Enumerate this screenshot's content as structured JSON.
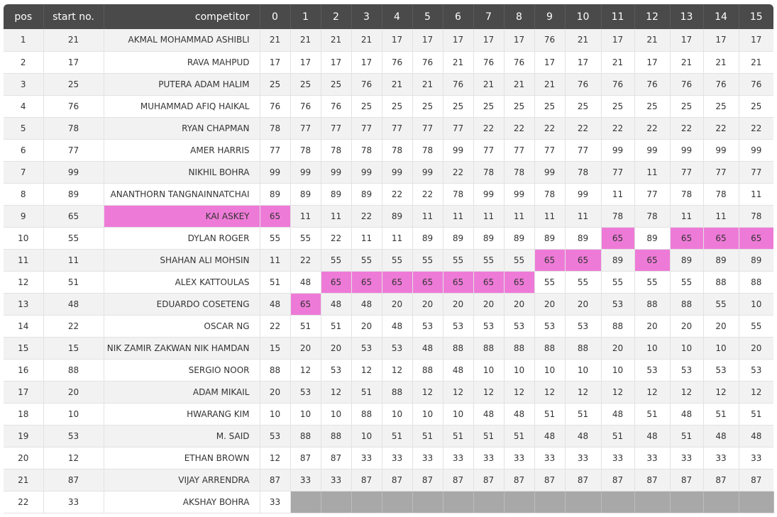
{
  "highlight_color": "#ee7ad7",
  "empty_color": "#a8a8a8",
  "header_color": "#4a4a4a",
  "highlighted_competitor": "KAI ASKEY",
  "highlighted_start_no": 65,
  "headers": {
    "pos": "pos",
    "start_no": "start no.",
    "competitor": "competitor",
    "laps": [
      "0",
      "1",
      "2",
      "3",
      "4",
      "5",
      "6",
      "7",
      "8",
      "9",
      "10",
      "11",
      "12",
      "13",
      "14",
      "15"
    ]
  },
  "rows": [
    {
      "pos": "1",
      "start_no": "21",
      "competitor": "AKMAL MOHAMMAD ASHIBLI",
      "laps": [
        "21",
        "21",
        "21",
        "21",
        "17",
        "17",
        "17",
        "17",
        "17",
        "76",
        "21",
        "17",
        "21",
        "17",
        "17",
        "17"
      ]
    },
    {
      "pos": "2",
      "start_no": "17",
      "competitor": "RAVA MAHPUD",
      "laps": [
        "17",
        "17",
        "17",
        "17",
        "76",
        "76",
        "21",
        "76",
        "76",
        "17",
        "17",
        "21",
        "17",
        "21",
        "21",
        "21"
      ]
    },
    {
      "pos": "3",
      "start_no": "25",
      "competitor": "PUTERA ADAM HALIM",
      "laps": [
        "25",
        "25",
        "25",
        "76",
        "21",
        "21",
        "76",
        "21",
        "21",
        "21",
        "76",
        "76",
        "76",
        "76",
        "76",
        "76"
      ]
    },
    {
      "pos": "4",
      "start_no": "76",
      "competitor": "MUHAMMAD AFIQ HAIKAL",
      "laps": [
        "76",
        "76",
        "76",
        "25",
        "25",
        "25",
        "25",
        "25",
        "25",
        "25",
        "25",
        "25",
        "25",
        "25",
        "25",
        "25"
      ]
    },
    {
      "pos": "5",
      "start_no": "78",
      "competitor": "RYAN CHAPMAN",
      "laps": [
        "78",
        "77",
        "77",
        "77",
        "77",
        "77",
        "77",
        "22",
        "22",
        "22",
        "22",
        "22",
        "22",
        "22",
        "22",
        "22"
      ]
    },
    {
      "pos": "6",
      "start_no": "77",
      "competitor": "AMER HARRIS",
      "laps": [
        "77",
        "78",
        "78",
        "78",
        "78",
        "78",
        "99",
        "77",
        "77",
        "77",
        "77",
        "99",
        "99",
        "99",
        "99",
        "99"
      ]
    },
    {
      "pos": "7",
      "start_no": "99",
      "competitor": "NIKHIL BOHRA",
      "laps": [
        "99",
        "99",
        "99",
        "99",
        "99",
        "99",
        "22",
        "78",
        "78",
        "99",
        "78",
        "77",
        "11",
        "77",
        "77",
        "77"
      ]
    },
    {
      "pos": "8",
      "start_no": "89",
      "competitor": "ANANTHORN TANGNAINNATCHAI",
      "laps": [
        "89",
        "89",
        "89",
        "89",
        "22",
        "22",
        "78",
        "99",
        "99",
        "78",
        "99",
        "11",
        "77",
        "78",
        "78",
        "11"
      ]
    },
    {
      "pos": "9",
      "start_no": "65",
      "competitor": "KAI ASKEY",
      "laps": [
        "65",
        "11",
        "11",
        "22",
        "89",
        "11",
        "11",
        "11",
        "11",
        "11",
        "11",
        "78",
        "78",
        "11",
        "11",
        "78"
      ]
    },
    {
      "pos": "10",
      "start_no": "55",
      "competitor": "DYLAN ROGER",
      "laps": [
        "55",
        "55",
        "22",
        "11",
        "11",
        "89",
        "89",
        "89",
        "89",
        "89",
        "89",
        "65",
        "89",
        "65",
        "65",
        "65"
      ]
    },
    {
      "pos": "11",
      "start_no": "11",
      "competitor": "SHAHAN ALI MOHSIN",
      "laps": [
        "11",
        "22",
        "55",
        "55",
        "55",
        "55",
        "55",
        "55",
        "55",
        "65",
        "65",
        "89",
        "65",
        "89",
        "89",
        "89"
      ]
    },
    {
      "pos": "12",
      "start_no": "51",
      "competitor": "ALEX KATTOULAS",
      "laps": [
        "51",
        "48",
        "65",
        "65",
        "65",
        "65",
        "65",
        "65",
        "65",
        "55",
        "55",
        "55",
        "55",
        "55",
        "88",
        "88"
      ]
    },
    {
      "pos": "13",
      "start_no": "48",
      "competitor": "EDUARDO COSETENG",
      "laps": [
        "48",
        "65",
        "48",
        "48",
        "20",
        "20",
        "20",
        "20",
        "20",
        "20",
        "20",
        "53",
        "88",
        "88",
        "55",
        "10"
      ]
    },
    {
      "pos": "14",
      "start_no": "22",
      "competitor": "OSCAR NG",
      "laps": [
        "22",
        "51",
        "51",
        "20",
        "48",
        "53",
        "53",
        "53",
        "53",
        "53",
        "53",
        "88",
        "20",
        "20",
        "20",
        "55"
      ]
    },
    {
      "pos": "15",
      "start_no": "15",
      "competitor": "NIK ZAMIR ZAKWAN NIK HAMDAN",
      "laps": [
        "15",
        "20",
        "20",
        "53",
        "53",
        "48",
        "88",
        "88",
        "88",
        "88",
        "88",
        "20",
        "10",
        "10",
        "10",
        "20"
      ]
    },
    {
      "pos": "16",
      "start_no": "88",
      "competitor": "SERGIO NOOR",
      "laps": [
        "88",
        "12",
        "53",
        "12",
        "12",
        "88",
        "48",
        "10",
        "10",
        "10",
        "10",
        "10",
        "53",
        "53",
        "53",
        "53"
      ]
    },
    {
      "pos": "17",
      "start_no": "20",
      "competitor": "ADAM MIKAIL",
      "laps": [
        "20",
        "53",
        "12",
        "51",
        "88",
        "12",
        "12",
        "12",
        "12",
        "12",
        "12",
        "12",
        "12",
        "12",
        "12",
        "12"
      ]
    },
    {
      "pos": "18",
      "start_no": "10",
      "competitor": "HWARANG KIM",
      "laps": [
        "10",
        "10",
        "10",
        "88",
        "10",
        "10",
        "10",
        "48",
        "48",
        "51",
        "51",
        "48",
        "51",
        "48",
        "51",
        "51"
      ]
    },
    {
      "pos": "19",
      "start_no": "53",
      "competitor": "M. SAID",
      "laps": [
        "53",
        "88",
        "88",
        "10",
        "51",
        "51",
        "51",
        "51",
        "51",
        "48",
        "48",
        "51",
        "48",
        "51",
        "48",
        "48"
      ]
    },
    {
      "pos": "20",
      "start_no": "12",
      "competitor": "ETHAN BROWN",
      "laps": [
        "12",
        "87",
        "87",
        "33",
        "33",
        "33",
        "33",
        "33",
        "33",
        "33",
        "33",
        "33",
        "33",
        "33",
        "33",
        "33"
      ]
    },
    {
      "pos": "21",
      "start_no": "87",
      "competitor": "VIJAY ARRENDRA",
      "laps": [
        "87",
        "33",
        "33",
        "87",
        "87",
        "87",
        "87",
        "87",
        "87",
        "87",
        "87",
        "87",
        "87",
        "87",
        "87",
        "87"
      ]
    },
    {
      "pos": "22",
      "start_no": "33",
      "competitor": "AKSHAY BOHRA",
      "laps": [
        "33",
        "",
        "",
        "",
        "",
        "",
        "",
        "",
        "",
        "",
        "",
        "",
        "",
        "",
        "",
        ""
      ]
    }
  ]
}
